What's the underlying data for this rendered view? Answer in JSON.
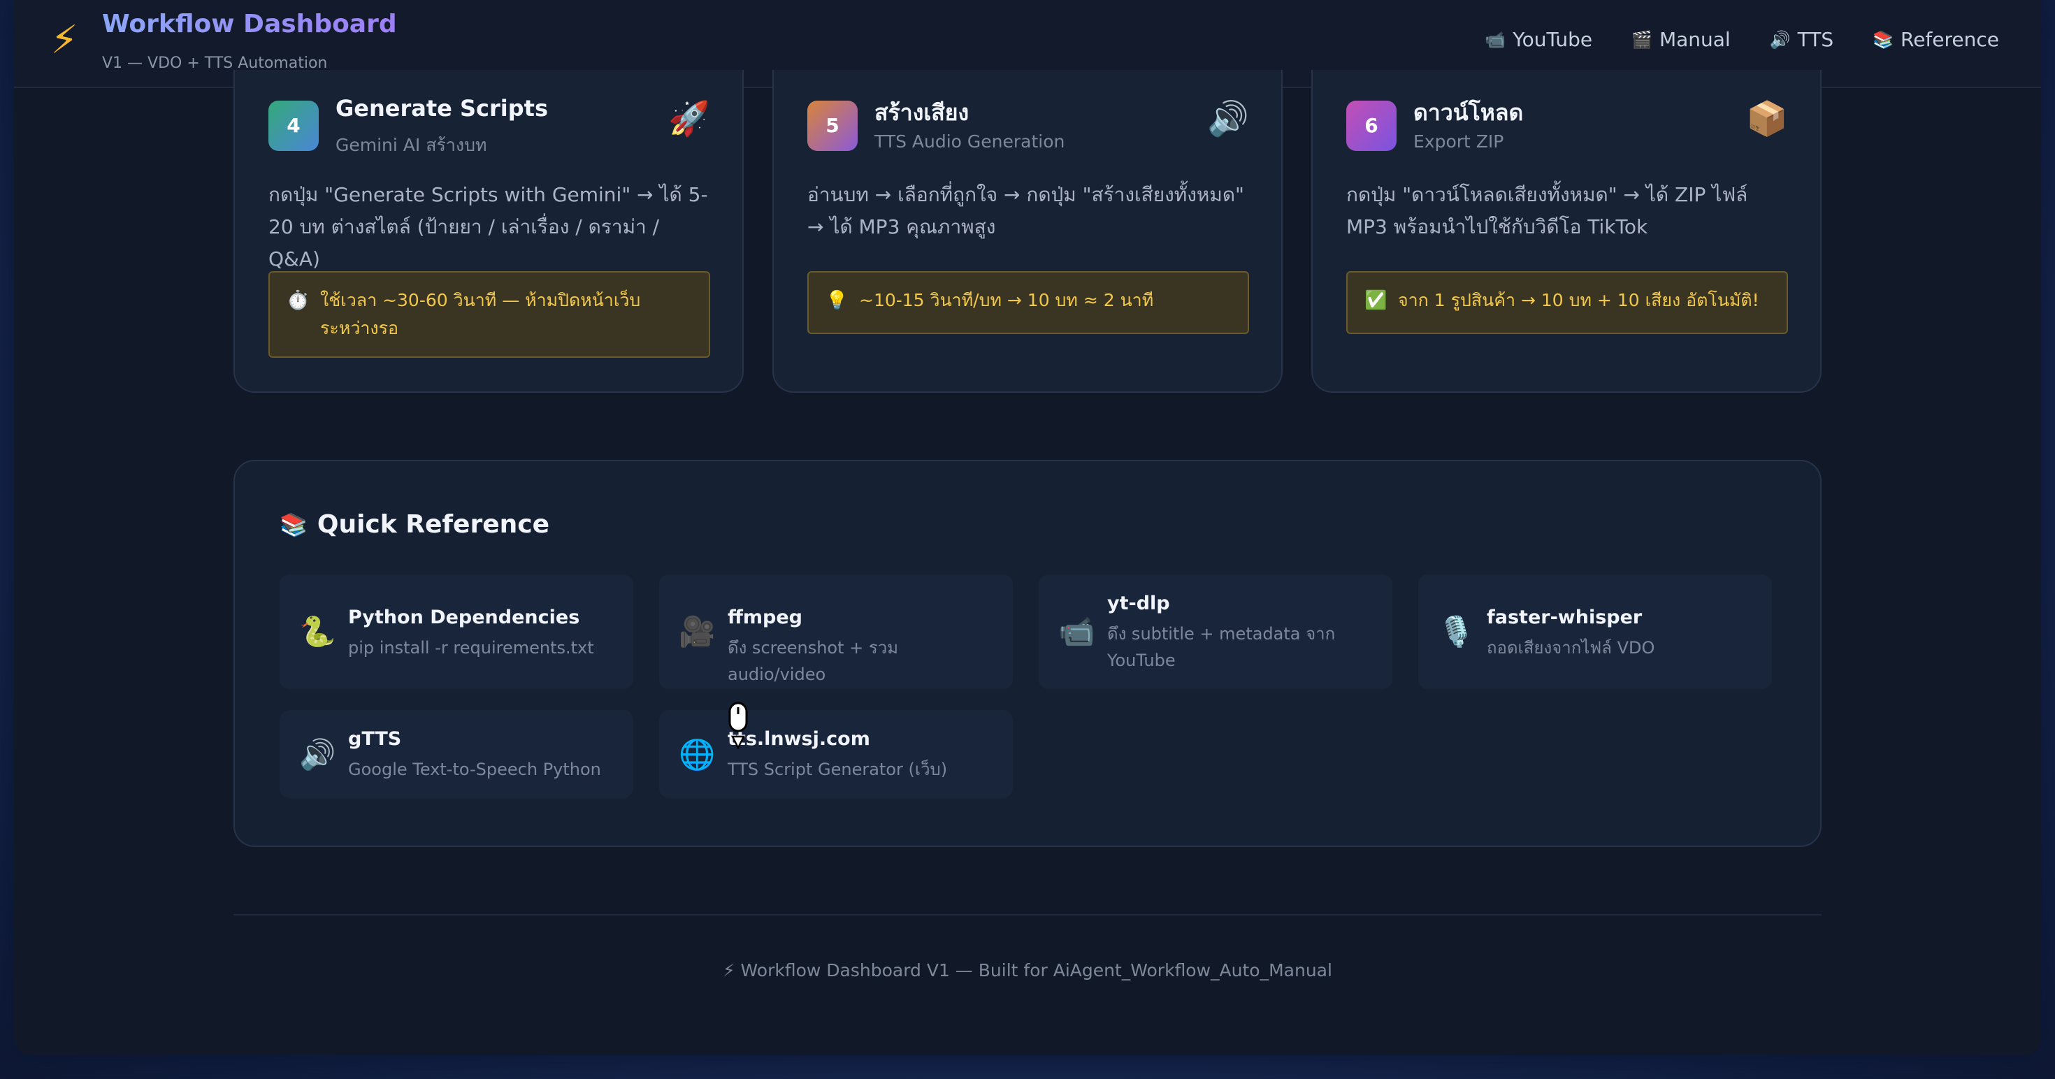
{
  "header": {
    "title": "Workflow Dashboard",
    "subtitle": "V1 — VDO + TTS Automation",
    "nav": [
      {
        "icon": "📹",
        "label": "YouTube"
      },
      {
        "icon": "🎬",
        "label": "Manual"
      },
      {
        "icon": "🔊",
        "label": "TTS"
      },
      {
        "icon": "📚",
        "label": "Reference"
      }
    ]
  },
  "steps": [
    {
      "number": "4",
      "title": "Generate Scripts",
      "subtitle": "Gemini AI สร้างบท",
      "emoji": "🚀",
      "description": "กดปุ่ม \"Generate Scripts with Gemini\" → ได้ 5-20 บท ต่างสไตล์ (ป้ายยา / เล่าเรื่อง / ดราม่า / Q&A)",
      "note_icon": "⏱️",
      "note": "ใช้เวลา ~30-60 วินาที — ห้ามปิดหน้าเว็บระหว่างรอ"
    },
    {
      "number": "5",
      "title": "สร้างเสียง",
      "subtitle": "TTS Audio Generation",
      "emoji": "🔊",
      "description": "อ่านบท → เลือกที่ถูกใจ → กดปุ่ม \"สร้างเสียงทั้งหมด\" → ได้ MP3 คุณภาพสูง",
      "note_icon": "💡",
      "note": "~10-15 วินาที/บท → 10 บท ≈ 2 นาที"
    },
    {
      "number": "6",
      "title": "ดาวน์โหลด",
      "subtitle": "Export ZIP",
      "emoji": "📦",
      "description": "กดปุ่ม \"ดาวน์โหลดเสียงทั้งหมด\" → ได้ ZIP ไฟล์ MP3 พร้อมนำไปใช้กับวิดีโอ TikTok",
      "note_icon": "✅",
      "note": "จาก 1 รูปสินค้า → 10 บท + 10 เสียง อัตโนมัติ!"
    }
  ],
  "quick_reference": {
    "icon": "📚",
    "title": "Quick Reference",
    "items": [
      {
        "icon": "🐍",
        "name": "Python Dependencies",
        "desc": "pip install -r requirements.txt"
      },
      {
        "icon": "🎥",
        "name": "ffmpeg",
        "desc": "ดึง screenshot + รวม audio/video"
      },
      {
        "icon": "📹",
        "name": "yt-dlp",
        "desc": "ดึง subtitle + metadata จาก YouTube"
      },
      {
        "icon": "🎙️",
        "name": "faster-whisper",
        "desc": "ถอดเสียงจากไฟล์ VDO"
      },
      {
        "icon": "🔊",
        "name": "gTTS",
        "desc": "Google Text-to-Speech Python"
      },
      {
        "icon": "🌐",
        "name": "tts.lnwsj.com",
        "desc": "TTS Script Generator (เว็บ)"
      }
    ]
  },
  "footer": {
    "text": "⚡ Workflow Dashboard V1 — Built for AiAgent_Workflow_Auto_Manual"
  }
}
